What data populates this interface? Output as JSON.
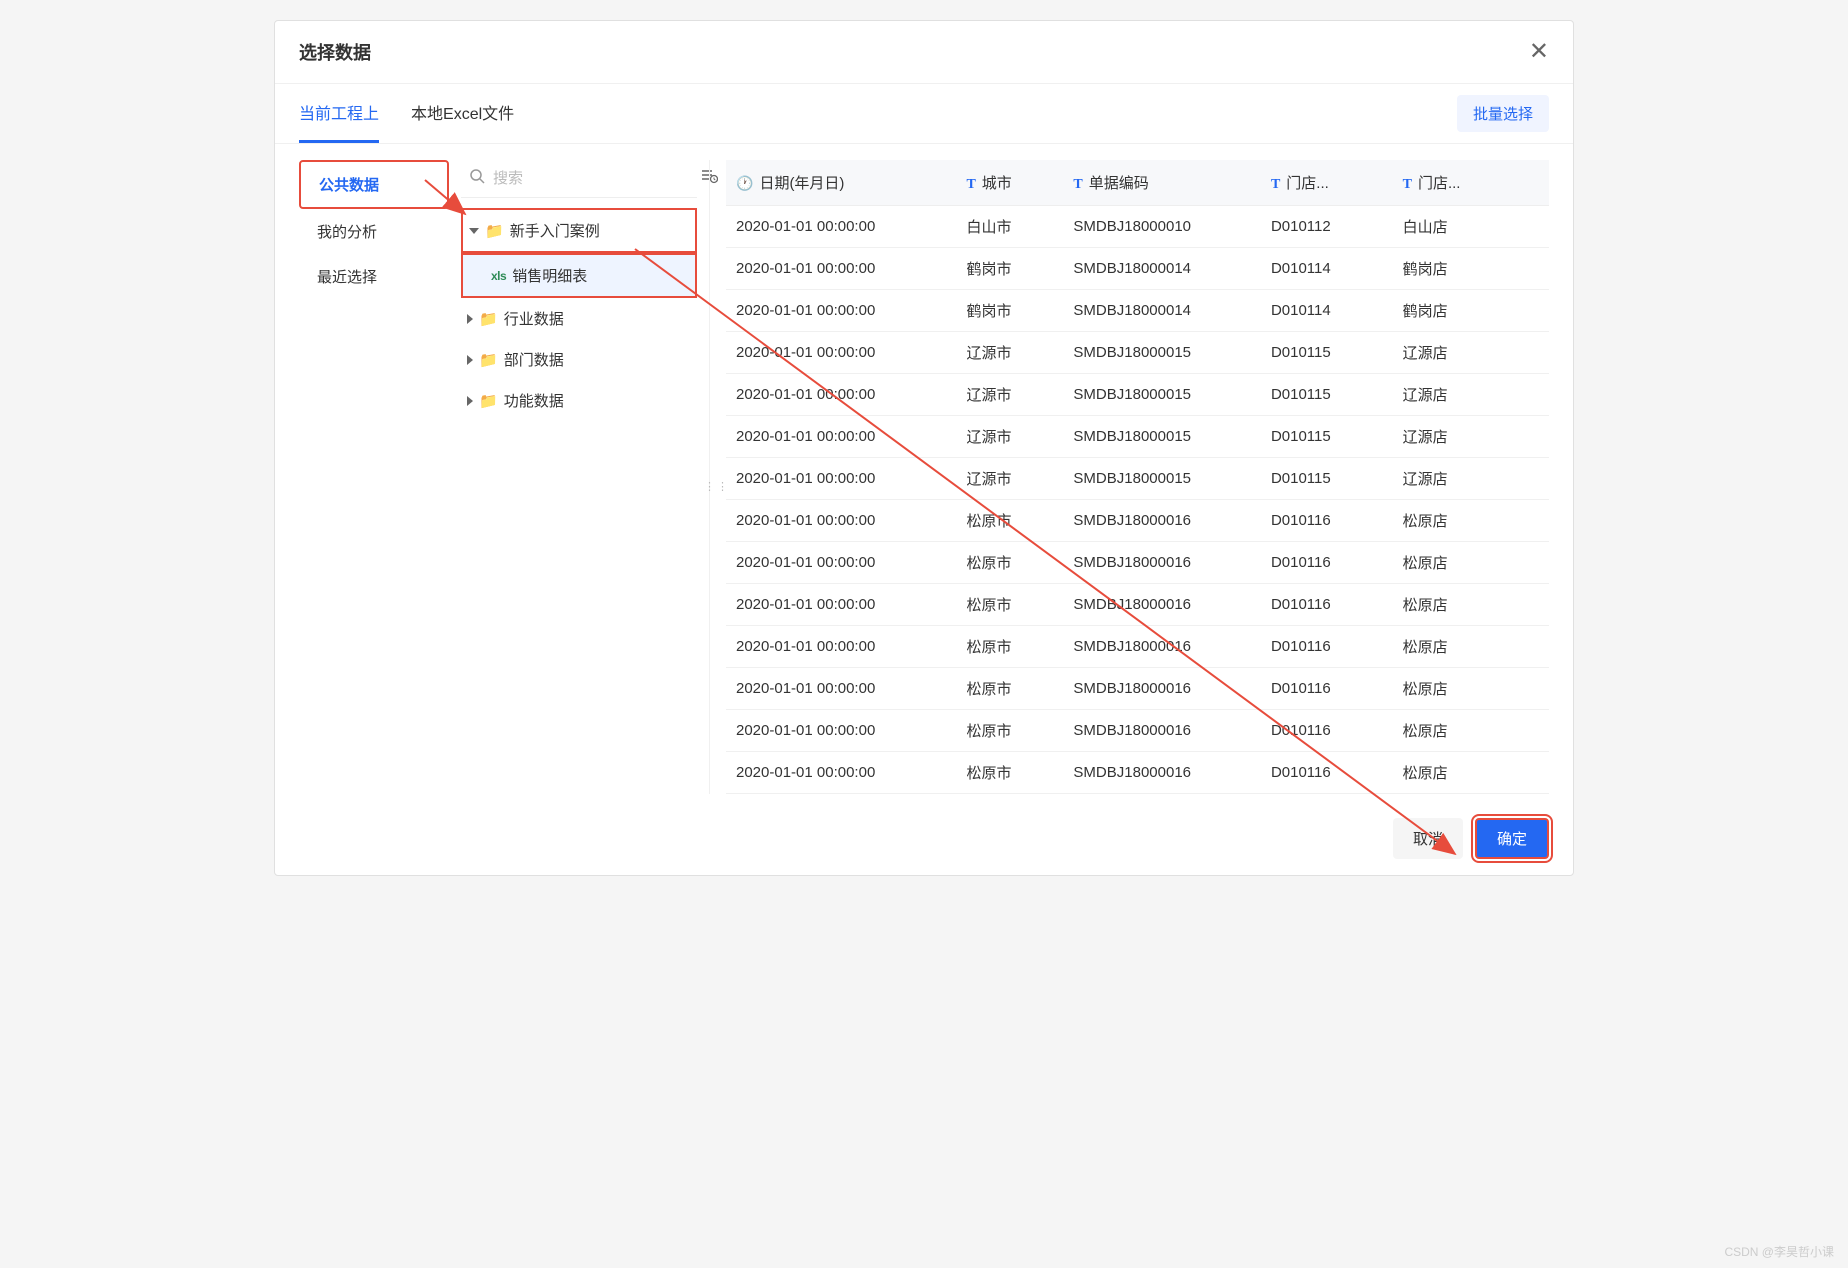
{
  "dialog": {
    "title": "选择数据"
  },
  "tabs": {
    "current": "当前工程上",
    "local": "本地Excel文件"
  },
  "batch_btn": "批量选择",
  "sidebar": {
    "items": [
      {
        "label": "公共数据",
        "active": true
      },
      {
        "label": "我的分析",
        "active": false
      },
      {
        "label": "最近选择",
        "active": false
      }
    ]
  },
  "search": {
    "placeholder": "搜索"
  },
  "tree": {
    "items": [
      {
        "label": "新手入门案例",
        "type": "folder",
        "expanded": true,
        "outlined": true
      },
      {
        "label": "销售明细表",
        "type": "xls",
        "selected": true
      },
      {
        "label": "行业数据",
        "type": "folder",
        "expanded": false
      },
      {
        "label": "部门数据",
        "type": "folder",
        "expanded": false
      },
      {
        "label": "功能数据",
        "type": "folder",
        "expanded": false
      }
    ]
  },
  "table": {
    "columns": [
      {
        "icon": "clock",
        "label": "日期(年月日)"
      },
      {
        "icon": "T",
        "label": "城市"
      },
      {
        "icon": "T",
        "label": "单据编码"
      },
      {
        "icon": "T",
        "label": "门店..."
      },
      {
        "icon": "T",
        "label": "门店..."
      }
    ],
    "rows": [
      [
        "2020-01-01 00:00:00",
        "白山市",
        "SMDBJ18000010",
        "D010112",
        "白山店"
      ],
      [
        "2020-01-01 00:00:00",
        "鹤岗市",
        "SMDBJ18000014",
        "D010114",
        "鹤岗店"
      ],
      [
        "2020-01-01 00:00:00",
        "鹤岗市",
        "SMDBJ18000014",
        "D010114",
        "鹤岗店"
      ],
      [
        "2020-01-01 00:00:00",
        "辽源市",
        "SMDBJ18000015",
        "D010115",
        "辽源店"
      ],
      [
        "2020-01-01 00:00:00",
        "辽源市",
        "SMDBJ18000015",
        "D010115",
        "辽源店"
      ],
      [
        "2020-01-01 00:00:00",
        "辽源市",
        "SMDBJ18000015",
        "D010115",
        "辽源店"
      ],
      [
        "2020-01-01 00:00:00",
        "辽源市",
        "SMDBJ18000015",
        "D010115",
        "辽源店"
      ],
      [
        "2020-01-01 00:00:00",
        "松原市",
        "SMDBJ18000016",
        "D010116",
        "松原店"
      ],
      [
        "2020-01-01 00:00:00",
        "松原市",
        "SMDBJ18000016",
        "D010116",
        "松原店"
      ],
      [
        "2020-01-01 00:00:00",
        "松原市",
        "SMDBJ18000016",
        "D010116",
        "松原店"
      ],
      [
        "2020-01-01 00:00:00",
        "松原市",
        "SMDBJ18000016",
        "D010116",
        "松原店"
      ],
      [
        "2020-01-01 00:00:00",
        "松原市",
        "SMDBJ18000016",
        "D010116",
        "松原店"
      ],
      [
        "2020-01-01 00:00:00",
        "松原市",
        "SMDBJ18000016",
        "D010116",
        "松原店"
      ],
      [
        "2020-01-01 00:00:00",
        "松原市",
        "SMDBJ18000016",
        "D010116",
        "松原店"
      ]
    ]
  },
  "footer": {
    "cancel": "取消",
    "ok": "确定"
  },
  "watermark": "CSDN @李昊哲小课"
}
